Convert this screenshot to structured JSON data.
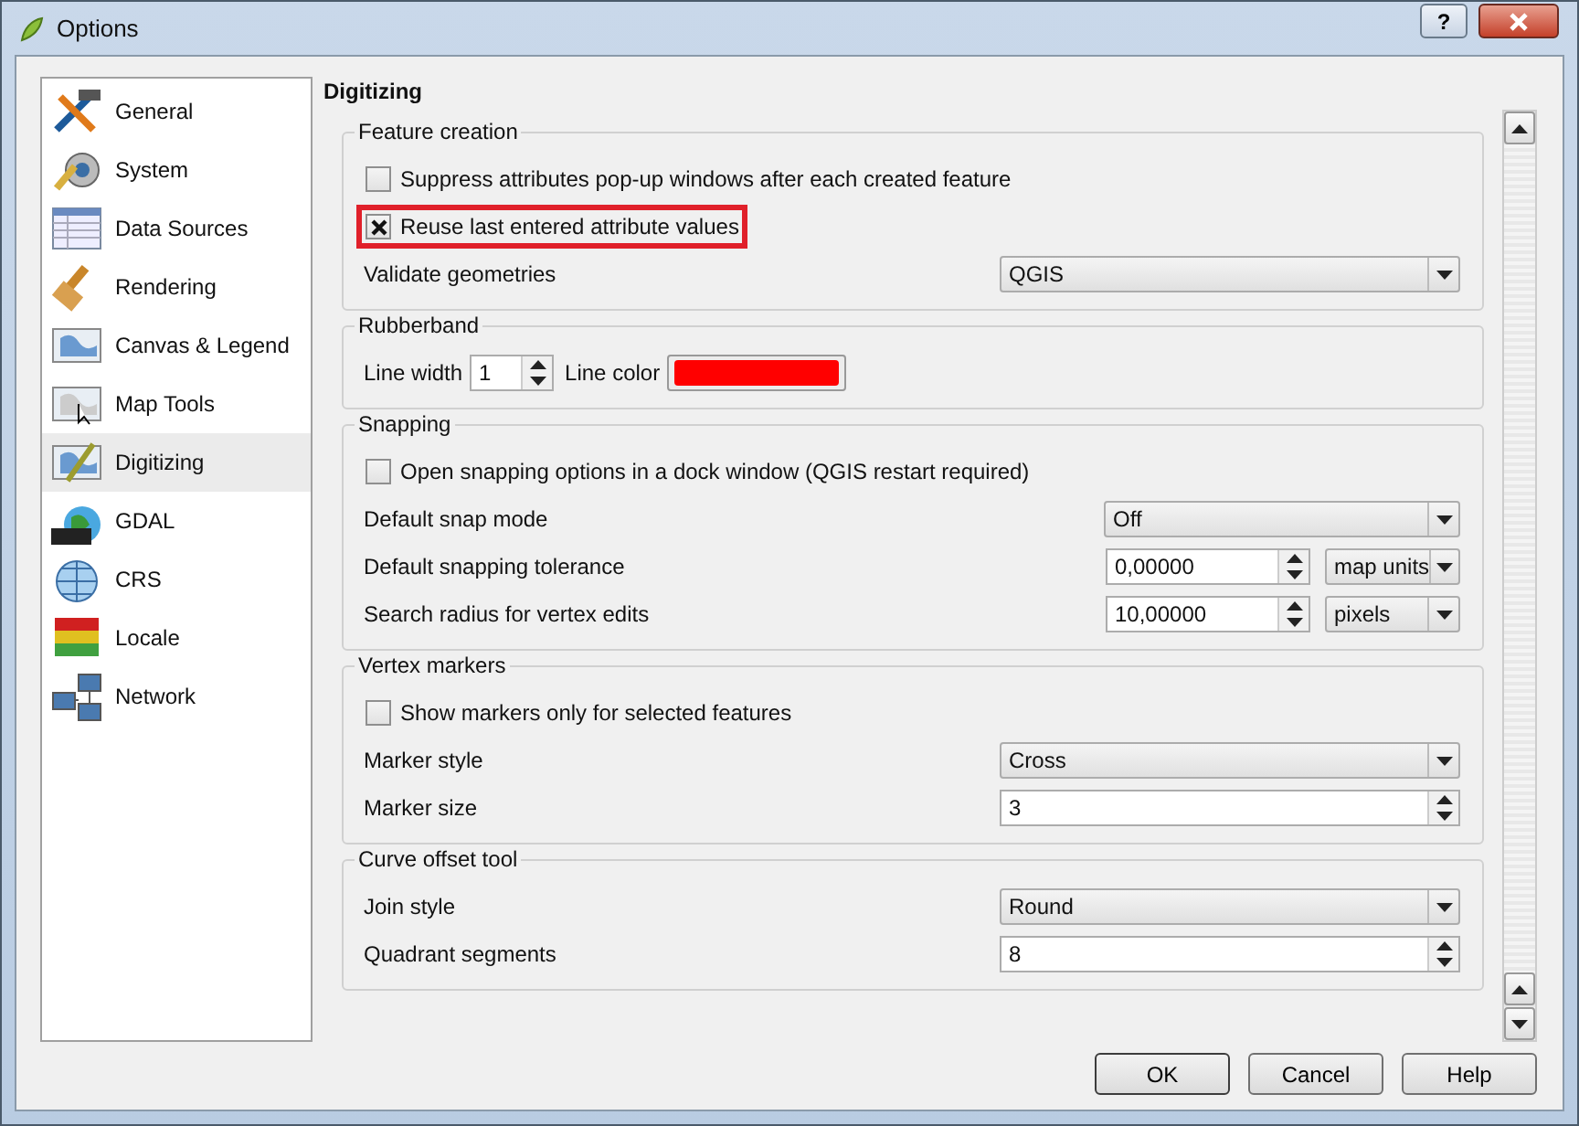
{
  "window": {
    "title": "Options",
    "help_button": "?"
  },
  "sidebar": {
    "items": [
      {
        "label": "General",
        "selected": false
      },
      {
        "label": "System",
        "selected": false
      },
      {
        "label": "Data Sources",
        "selected": false
      },
      {
        "label": "Rendering",
        "selected": false
      },
      {
        "label": "Canvas & Legend",
        "selected": false
      },
      {
        "label": "Map Tools",
        "selected": false
      },
      {
        "label": "Digitizing",
        "selected": true
      },
      {
        "label": "GDAL",
        "selected": false
      },
      {
        "label": "CRS",
        "selected": false
      },
      {
        "label": "Locale",
        "selected": false
      },
      {
        "label": "Network",
        "selected": false
      }
    ]
  },
  "page_title": "Digitizing",
  "groups": [
    {
      "title": "Feature creation",
      "rows": [
        {
          "kind": "checkbox",
          "label": "Suppress attributes pop-up windows after each created feature",
          "checked": false,
          "highlighted": false
        },
        {
          "kind": "checkbox",
          "label": "Reuse last entered attribute values",
          "checked": true,
          "highlighted": true
        },
        {
          "kind": "select",
          "label": "Validate geometries",
          "value": "QGIS"
        }
      ]
    },
    {
      "title": "Rubberband",
      "rows": [
        {
          "kind": "line",
          "width_label": "Line width",
          "width_value": "1",
          "color_label": "Line color",
          "color": "#ff0000"
        }
      ]
    },
    {
      "title": "Snapping",
      "rows": [
        {
          "kind": "checkbox",
          "label": "Open snapping options in a dock window (QGIS restart required)",
          "checked": false,
          "highlighted": false
        },
        {
          "kind": "select",
          "label": "Default snap mode",
          "value": "Off",
          "narrow": true
        },
        {
          "kind": "spin_unit",
          "label": "Default snapping tolerance",
          "value": "0,00000",
          "unit": "map units"
        },
        {
          "kind": "spin_unit",
          "label": "Search radius for vertex edits",
          "value": "10,00000",
          "unit": "pixels"
        }
      ]
    },
    {
      "title": "Vertex markers",
      "rows": [
        {
          "kind": "checkbox",
          "label": "Show markers only for selected features",
          "checked": false,
          "highlighted": false
        },
        {
          "kind": "select",
          "label": "Marker style",
          "value": "Cross"
        },
        {
          "kind": "spin",
          "label": "Marker size",
          "value": "3"
        }
      ]
    },
    {
      "title": "Curve offset tool",
      "rows": [
        {
          "kind": "select",
          "label": "Join style",
          "value": "Round"
        },
        {
          "kind": "spin",
          "label": "Quadrant segments",
          "value": "8"
        }
      ]
    }
  ],
  "buttons": [
    "OK",
    "Cancel",
    "Help"
  ]
}
